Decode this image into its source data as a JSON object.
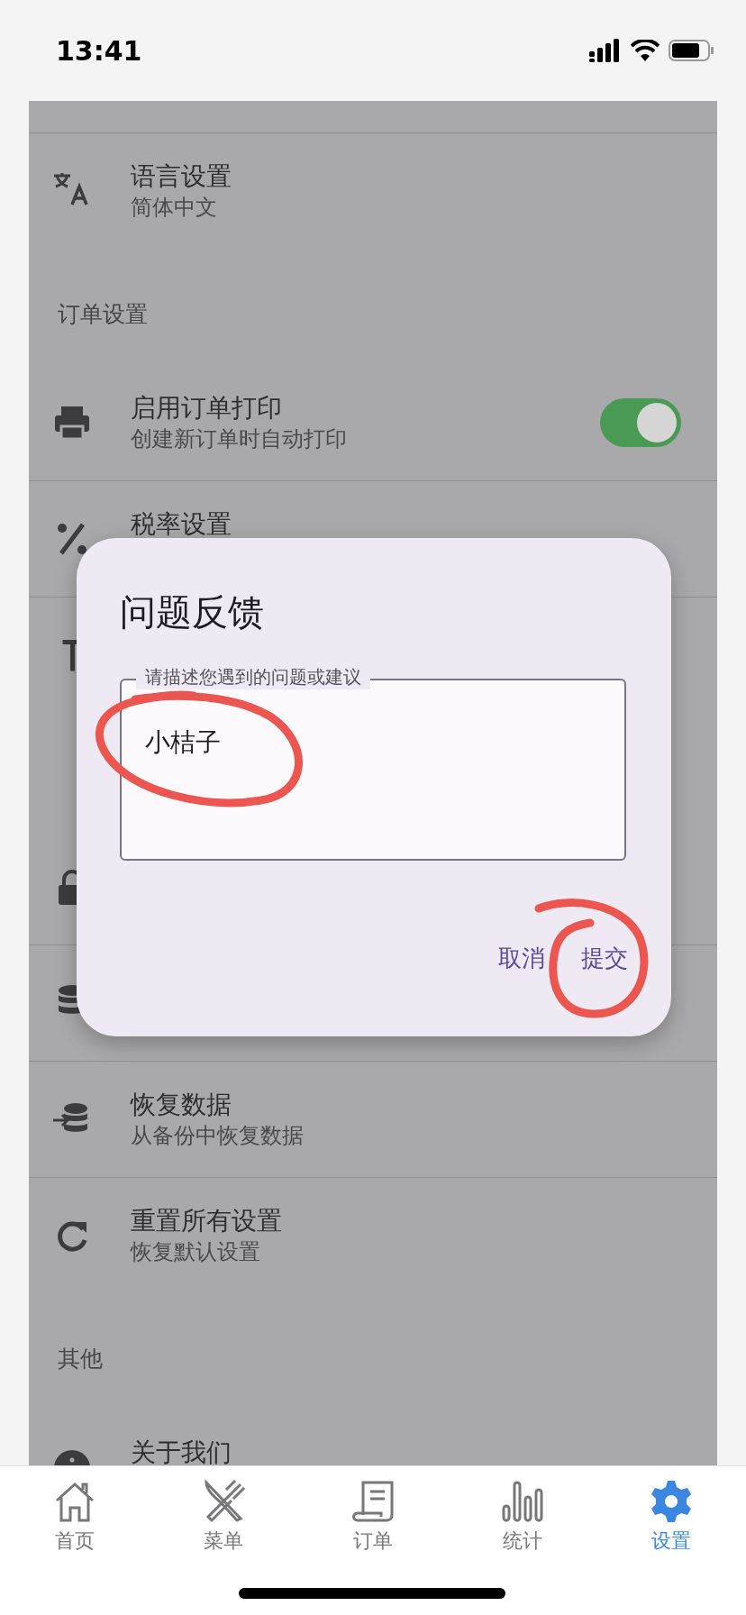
{
  "status_bar": {
    "time": "13:41"
  },
  "settings": [
    {
      "kind": "row",
      "title": "语言设置",
      "subtitle": "简体中文"
    },
    {
      "kind": "header",
      "title": "订单设置"
    },
    {
      "kind": "toggle",
      "title": "启用订单打印",
      "subtitle": "创建新订单时自动打印",
      "on": true
    },
    {
      "kind": "row",
      "title": "税率设置"
    },
    {
      "kind": "row"
    },
    {
      "kind": "header"
    },
    {
      "kind": "row"
    },
    {
      "kind": "row"
    },
    {
      "kind": "row",
      "title": "恢复数据",
      "subtitle": "从备份中恢复数据"
    },
    {
      "kind": "row",
      "title": "重置所有设置",
      "subtitle": "恢复默认设置"
    },
    {
      "kind": "header",
      "title": "其他"
    },
    {
      "kind": "row",
      "title": "关于我们"
    }
  ],
  "dialog": {
    "title": "问题反馈",
    "field": {
      "label": "请描述您遇到的问题或建议",
      "value": "小桔子"
    },
    "buttons": [
      "取消",
      "提交"
    ]
  },
  "tab_bar": [
    {
      "label": "首页",
      "selected": false
    },
    {
      "label": "菜单",
      "selected": false
    },
    {
      "label": "订单",
      "selected": false
    },
    {
      "label": "统计",
      "selected": false
    },
    {
      "label": "设置",
      "selected": true
    }
  ]
}
